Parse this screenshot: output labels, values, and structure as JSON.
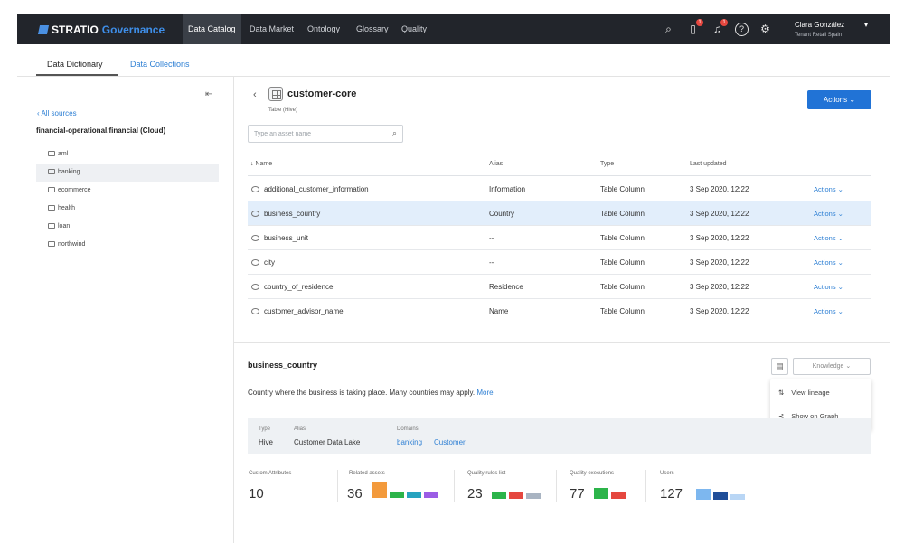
{
  "brand": {
    "name": "STRATIO",
    "product": "Governance"
  },
  "nav": {
    "tabs": [
      "Data Catalog",
      "Data Market",
      "Ontology",
      "Glossary",
      "Quality"
    ],
    "active": "Data Catalog"
  },
  "top_icons": [
    {
      "name": "search-icon",
      "glyph": "⌕",
      "badge": ""
    },
    {
      "name": "clipboard-icon",
      "glyph": "▯",
      "badge": "1"
    },
    {
      "name": "bell-icon",
      "glyph": "♫",
      "badge": "1"
    },
    {
      "name": "help-icon",
      "glyph": "?",
      "badge": ""
    },
    {
      "name": "gear-icon",
      "glyph": "⚙",
      "badge": ""
    }
  ],
  "user": {
    "name": "Clara González",
    "tenant": "Tenant Retail Spain",
    "caret": "▾"
  },
  "subtabs": {
    "dictionary": "Data Dictionary",
    "collections": "Data Collections"
  },
  "sidebar": {
    "collapse_glyph": "⇤",
    "back_label": "‹  All sources",
    "source_title": "financial-operational.financial (Cloud)",
    "items": [
      "aml",
      "banking",
      "ecommerce",
      "health",
      "loan",
      "northwind"
    ],
    "selected": "banking"
  },
  "asset": {
    "back_glyph": "‹",
    "title": "customer-core",
    "subtitle": "Table (Hive)",
    "actions_label": "Actions  ⌄"
  },
  "search": {
    "placeholder": "Type an asset name",
    "value": ""
  },
  "table": {
    "headers": {
      "name": "↓ Name",
      "alias": "Alias",
      "type": "Type",
      "updated": "Last updated"
    },
    "action_label": "Actions  ⌄",
    "rows": [
      {
        "name": "additional_customer_information",
        "alias": "Information",
        "type": "Table Column",
        "updated": "3 Sep 2020, 12:22",
        "selected": false
      },
      {
        "name": "business_country",
        "alias": "Country",
        "type": "Table Column",
        "updated": "3 Sep 2020, 12:22",
        "selected": true
      },
      {
        "name": "business_unit",
        "alias": "--",
        "type": "Table Column",
        "updated": "3 Sep 2020, 12:22",
        "selected": false
      },
      {
        "name": "city",
        "alias": "--",
        "type": "Table Column",
        "updated": "3 Sep 2020, 12:22",
        "selected": false
      },
      {
        "name": "country_of_residence",
        "alias": "Residence",
        "type": "Table Column",
        "updated": "3 Sep 2020, 12:22",
        "selected": false
      },
      {
        "name": "customer_advisor_name",
        "alias": "Name",
        "type": "Table Column",
        "updated": "3 Sep 2020, 12:22",
        "selected": false
      }
    ]
  },
  "detail": {
    "title": "business_country",
    "description": "Country where the business is taking place. Many countries may apply.",
    "more": "More",
    "knowledge_label": "Knowledge  ⌄",
    "menu": {
      "view_lineage": "View lineage",
      "show_graph": "Show on Graph"
    },
    "info": {
      "type_label": "Type",
      "type_value": "Hive",
      "alias_label": "Alias",
      "alias_value": "Customer Data Lake",
      "domains_label": "Domains",
      "domain_1": "banking",
      "domain_2": "Customer"
    },
    "stats": {
      "custom_label": "Custom Attributes",
      "custom_value": "10",
      "related_label": "Related assets",
      "related_value": "36",
      "rules_label": "Quality rules list",
      "rules_value": "23",
      "exec_label": "Quality executions",
      "exec_value": "77",
      "users_label": "Users",
      "users_value": "127"
    },
    "stat_colors": {
      "related": [
        "#f39a3c",
        "#2cb44a",
        "#27a3bf",
        "#9b5de5",
        "#2cb44a"
      ],
      "rules": [
        "#2cb44a",
        "#e5473f",
        "#a9b4c2"
      ],
      "exec": [
        "#2cb44a",
        "#e5473f"
      ],
      "users": [
        "#7db7ef",
        "#1f4e99",
        "#b9d6f5"
      ]
    }
  },
  "colors": {
    "accent": "#2173d6",
    "nav_bg": "#22252b",
    "selected_row": "#e2eefb"
  }
}
